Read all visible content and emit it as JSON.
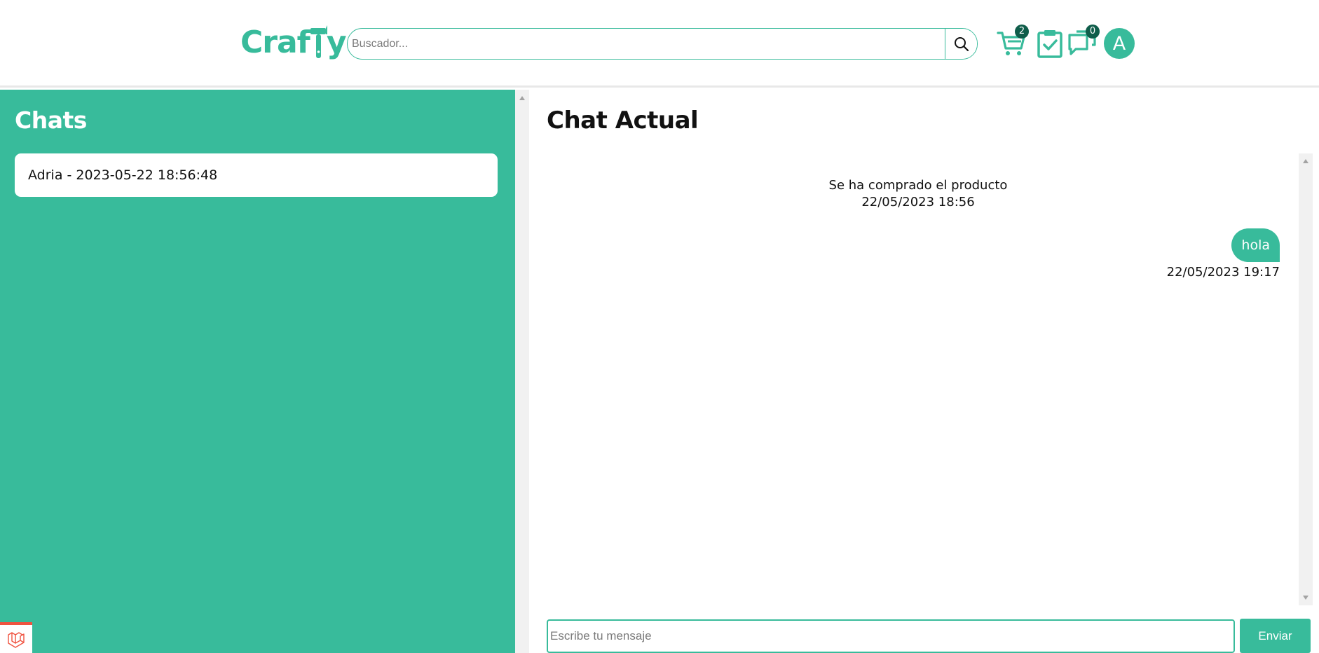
{
  "header": {
    "logo": {
      "pre": "Craf",
      "post": "y",
      "hammer_icon": "hammer-icon"
    },
    "search": {
      "placeholder": "Buscador...",
      "icon": "search-icon"
    },
    "cart": {
      "icon": "cart-icon",
      "count": "2"
    },
    "orders": {
      "icon": "clipboard-check-icon"
    },
    "messages": {
      "icon": "chat-bubbles-icon",
      "count": "0"
    },
    "avatar": {
      "initial": "A"
    }
  },
  "sidebar": {
    "title": "Chats",
    "chats": [
      {
        "label": "Adria - 2023-05-22 18:56:48"
      }
    ],
    "framework_badge_icon": "laravel-icon"
  },
  "chat": {
    "title": "Chat Actual",
    "system_message": {
      "text": "Se ha comprado el producto",
      "time": "22/05/2023 18:56"
    },
    "messages": [
      {
        "text": "hola",
        "time": "22/05/2023 19:17",
        "from_self": true
      }
    ],
    "compose": {
      "placeholder": "Escribe tu mensaje",
      "send_label": "Enviar"
    }
  },
  "colors": {
    "accent": "#38bb9b",
    "badge": "#0f5d4a",
    "laravel": "#f05340"
  }
}
